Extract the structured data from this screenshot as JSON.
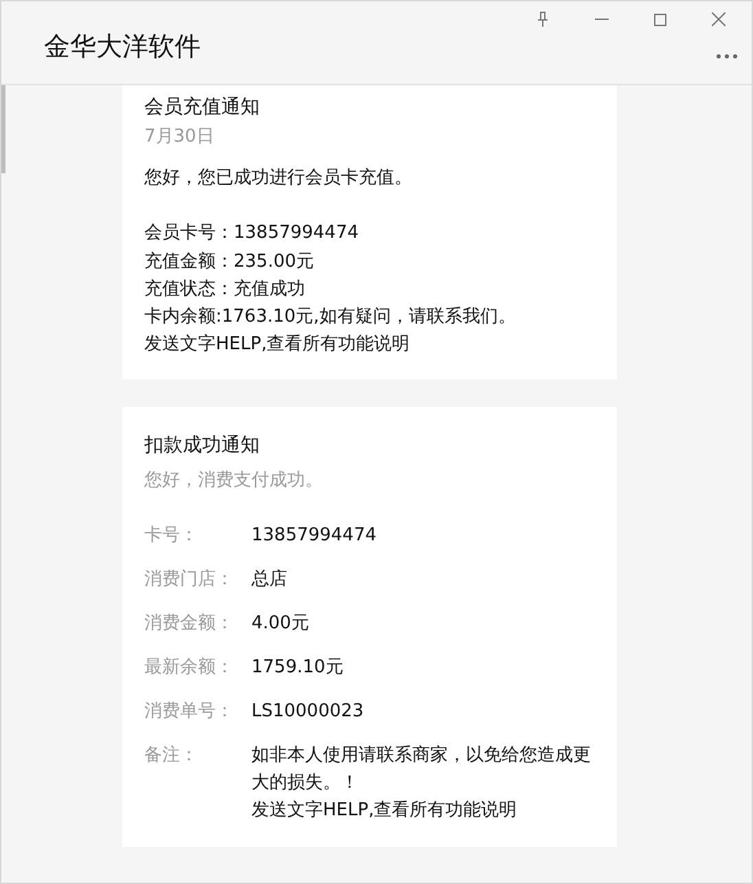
{
  "window": {
    "title": "金华大洋软件"
  },
  "recharge_card": {
    "title": "会员充值通知",
    "date": "7月30日",
    "greeting": "您好，您已成功进行会员卡充值。",
    "lines": [
      "会员卡号：13857994474",
      "充值金额：235.00元",
      "充值状态：充值成功",
      "卡内余额:1763.10元,如有疑问，请联系我们。",
      "发送文字HELP,查看所有功能说明"
    ]
  },
  "deduction_card": {
    "title": "扣款成功通知",
    "greeting": "您好，消费支付成功。",
    "fields": [
      {
        "label": "卡号：",
        "value": [
          "13857994474"
        ]
      },
      {
        "label": "消费门店：",
        "value": [
          "总店"
        ]
      },
      {
        "label": "消费金额：",
        "value": [
          "4.00元"
        ]
      },
      {
        "label": "最新余额：",
        "value": [
          "1759.10元"
        ]
      },
      {
        "label": "消费单号：",
        "value": [
          "LS10000023"
        ]
      },
      {
        "label": "备注：",
        "value": [
          "如非本人使用请联系商家，以免给您造成更大的损失。！",
          "发送文字HELP,查看所有功能说明"
        ]
      }
    ]
  }
}
